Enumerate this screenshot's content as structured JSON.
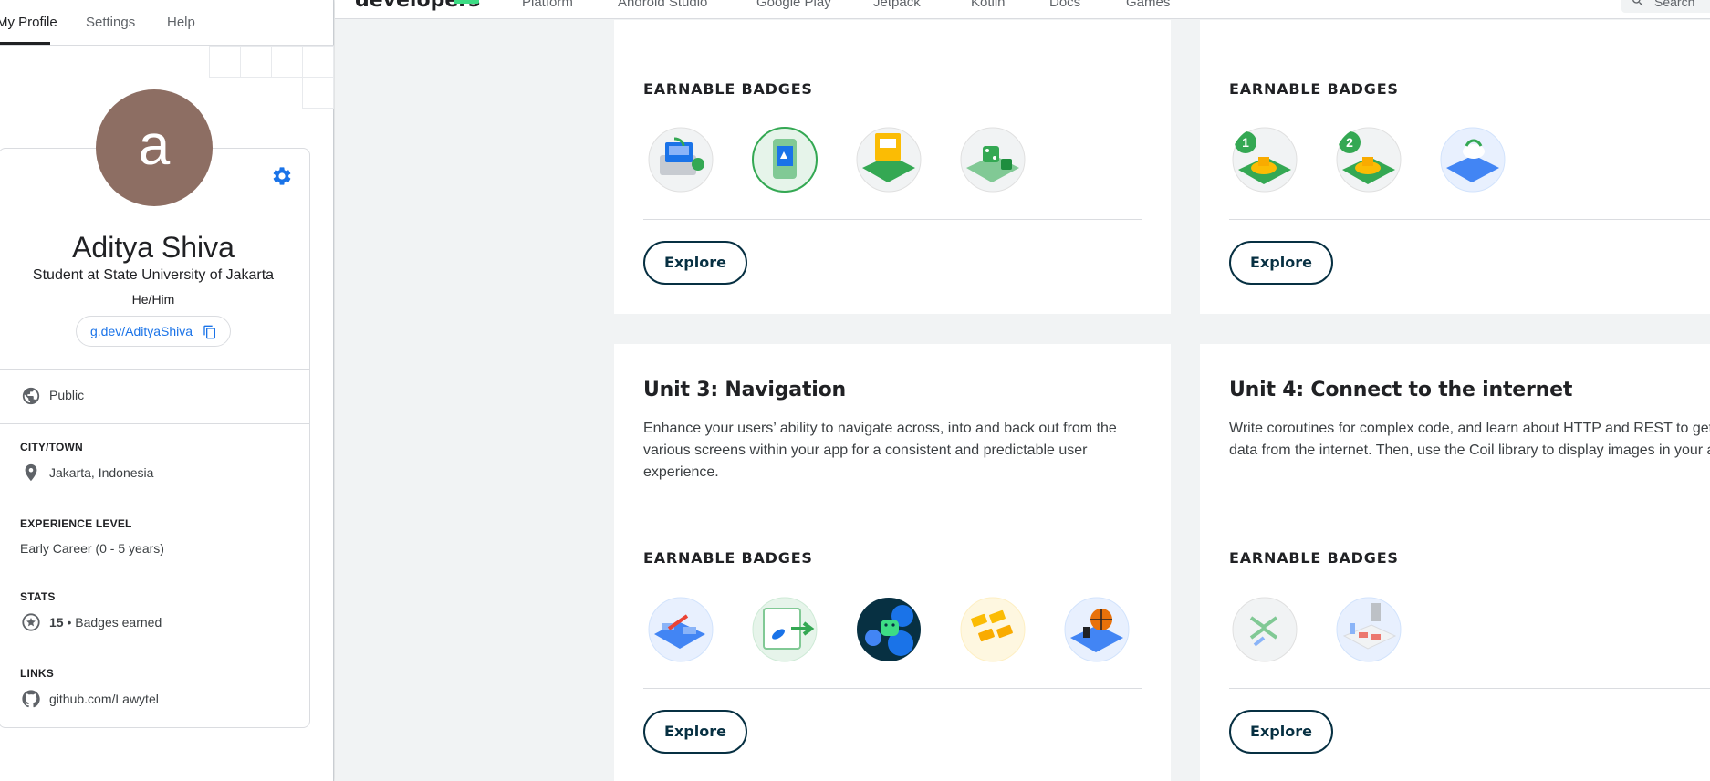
{
  "profile_tabs": [
    {
      "label": "My Profile"
    },
    {
      "label": "Settings"
    },
    {
      "label": "Help"
    }
  ],
  "profile": {
    "avatar_letter": "a",
    "avatar_color": "#8d6e63",
    "name": "Aditya Shiva",
    "headline": "Student at State University of Jakarta",
    "pronouns": "He/Him",
    "profile_link": "g.dev/AdityaShiva",
    "visibility": "Public",
    "city_label": "CITY/TOWN",
    "city": "Jakarta, Indonesia",
    "experience_label": "EXPERIENCE LEVEL",
    "experience": "Early Career (0 - 5 years)",
    "stats_label": "STATS",
    "badges_count": "15",
    "badges_text": " • Badges earned",
    "links_label": "LINKS",
    "github": "github.com/Lawytel"
  },
  "topnav": {
    "brand": "developers",
    "items": [
      "Platform",
      "Android Studio",
      "Google Play",
      "Jetpack",
      "Kotlin",
      "Docs",
      "Games"
    ],
    "search_placeholder": "Search"
  },
  "units": [
    {
      "title": "",
      "description": "",
      "badges_label": "EARNABLE BADGES",
      "explore_label": "Explore",
      "badge_count": 4
    },
    {
      "title": "",
      "description": "",
      "badges_label": "EARNABLE BADGES",
      "explore_label": "Explore",
      "badge_count": 3
    },
    {
      "title": "Unit 3: Navigation",
      "description": "Enhance your users’ ability to navigate across, into and back out from the various screens within your app for a consistent and predictable user experience.",
      "badges_label": "EARNABLE BADGES",
      "explore_label": "Explore",
      "badge_count": 5
    },
    {
      "title": "Unit 4: Connect to the internet",
      "description": "Write coroutines for complex code, and learn about HTTP and REST to get data from the internet. Then, use the Coil library to display images in your app.",
      "badges_label": "EARNABLE BADGES",
      "explore_label": "Explore",
      "badge_count": 2
    }
  ],
  "badge_numbers": [
    "1",
    "2"
  ],
  "colors": {
    "accent_blue": "#1a73e8",
    "android_green": "#3ddc84",
    "dark_teal": "#073042",
    "badge_green": "#34a853"
  }
}
